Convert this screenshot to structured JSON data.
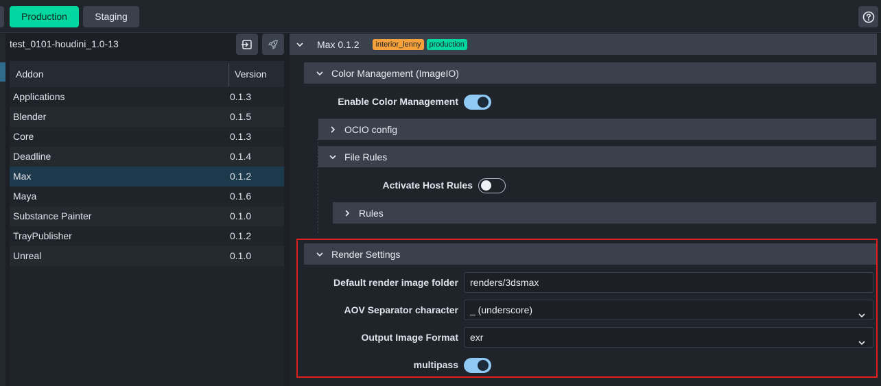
{
  "topbar": {
    "tabs": [
      {
        "label": "Production"
      },
      {
        "label": "Staging"
      }
    ],
    "help_icon": "question-circle-icon"
  },
  "left": {
    "project_name": "test_0101-houdini_1.0-13",
    "buttons": [
      "import-icon",
      "rocket-icon"
    ],
    "columns": {
      "addon": "Addon",
      "version": "Version"
    },
    "rows": [
      {
        "name": "Applications",
        "version": "0.1.3"
      },
      {
        "name": "Blender",
        "version": "0.1.5"
      },
      {
        "name": "Core",
        "version": "0.1.3"
      },
      {
        "name": "Deadline",
        "version": "0.1.4"
      },
      {
        "name": "Max",
        "version": "0.1.2",
        "selected": true
      },
      {
        "name": "Maya",
        "version": "0.1.6"
      },
      {
        "name": "Substance Painter",
        "version": "0.1.0"
      },
      {
        "name": "TrayPublisher",
        "version": "0.1.2"
      },
      {
        "name": "Unreal",
        "version": "0.1.0"
      }
    ]
  },
  "right": {
    "addon_title": "Max 0.1.2",
    "badges": [
      "interior_lenny",
      "production"
    ],
    "color_mgmt": {
      "title": "Color Management (ImageIO)",
      "enable_label": "Enable Color Management",
      "enable_value": true,
      "ocio_title": "OCIO config",
      "file_rules_title": "File Rules",
      "activate_label": "Activate Host Rules",
      "activate_value": false,
      "rules_title": "Rules"
    },
    "render": {
      "title": "Render Settings",
      "folder_label": "Default render image folder",
      "folder_value": "renders/3dsmax",
      "aov_label": "AOV Separator character",
      "aov_value": "_ (underscore)",
      "format_label": "Output Image Format",
      "format_value": "exr",
      "multipass_label": "multipass",
      "multipass_value": true
    }
  },
  "colors": {
    "accent": "#00d7a0",
    "badge_orange": "#f6a13a",
    "toggle_on": "#8fc9f4",
    "highlight": "#e0201c"
  }
}
